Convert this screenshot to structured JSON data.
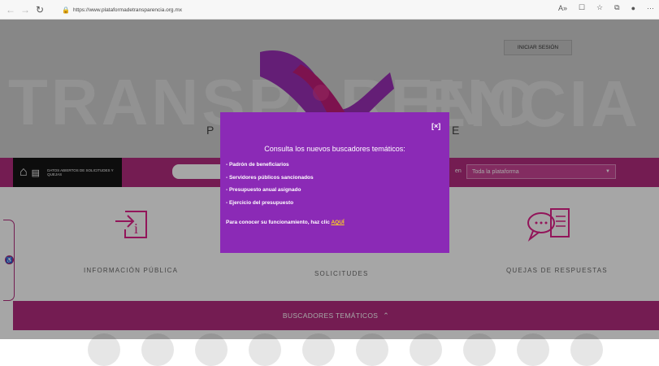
{
  "browser": {
    "url": "https://www.plataformadetransparencia.org.mx"
  },
  "header": {
    "login_label": "INICIAR SESIÓN",
    "hero_left_letter": "P",
    "hero_right_letter": "E"
  },
  "search_strip": {
    "open_data_label": "DATOS ABIERTOS DE SOLICITUDES Y QUEJAS",
    "scope_prefix": "en",
    "scope_value": "Toda la plataforma"
  },
  "cards": [
    {
      "label": "INFORMACIÓN PÚBLICA",
      "icon": "info-document-icon"
    },
    {
      "label": "SOLICITUDES",
      "icon": "request-icon"
    },
    {
      "label": "QUEJAS DE RESPUESTAS",
      "icon": "complaint-chat-icon"
    }
  ],
  "bottom": {
    "thematic_label": "BUSCADORES TEMÁTICOS"
  },
  "modal": {
    "close_label": "[×]",
    "title": "Consulta los nuevos buscadores temáticos:",
    "items": [
      "- Padrón de beneficiarios",
      "- Servidores públicos sancionados",
      "- Presupuesto anual asignado",
      "- Ejercicio del presupuesto"
    ],
    "footer_text": "Para conocer su funcionamiento, haz clic ",
    "footer_link": "AQUÍ"
  },
  "colors": {
    "brand_magenta": "#b22c7e",
    "modal_purple": "#8b2ab6",
    "link_yellow": "#ffd21f"
  }
}
